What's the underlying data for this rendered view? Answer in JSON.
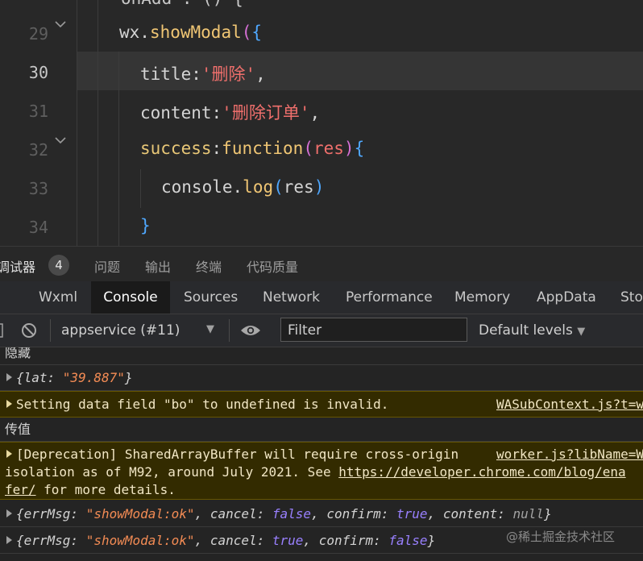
{
  "editor": {
    "line_numbers": [
      "29",
      "30",
      "31",
      "32",
      "33",
      "34"
    ],
    "active_line": "30",
    "top_partial": "onAdd : () {",
    "lines": {
      "l29_obj": "wx",
      "l29_dot": ".",
      "l29_fn": "showModal",
      "l29_paren": "(",
      "l29_brace": "{",
      "l30_key": "title",
      "l30_colon": ":",
      "l30_str": "'删除'",
      "l30_comma": ",",
      "l31_key": "content",
      "l31_colon": ":",
      "l31_str": "'删除订单'",
      "l31_comma": ",",
      "l32_key": "success",
      "l32_colon": ":",
      "l32_fn": "function",
      "l32_paren": "(",
      "l32_arg": "res",
      "l32_close": ")",
      "l32_brace": "{",
      "l33_obj": "console",
      "l33_dot": ".",
      "l33_fn": "log",
      "l33_paren": "(",
      "l33_arg": "res",
      "l33_close": ")",
      "l34_brace": "}"
    }
  },
  "panel_tabs": {
    "debugger": "调试器",
    "badge": "4",
    "problems": "问题",
    "output": "输出",
    "terminal": "终端",
    "quality": "代码质量"
  },
  "devtools_tabs": {
    "left_cut": "⴮",
    "wxml": "Wxml",
    "console": "Console",
    "sources": "Sources",
    "network": "Network",
    "performance": "Performance",
    "memory": "Memory",
    "appdata": "AppData",
    "storage": "Sto"
  },
  "toolbar": {
    "context": "appservice (#11)",
    "filter_placeholder": "Filter",
    "levels": "Default levels"
  },
  "console": {
    "r1": "隐藏",
    "r2_open": "{lat: ",
    "r2_val": "\"39.887\"",
    "r2_close": "}",
    "r3": "Setting data field \"bo\" to undefined is invalid.",
    "r3_src": "WASubContext.js?t=w",
    "r4": "传值",
    "r5_line1": "[Deprecation] SharedArrayBuffer will require cross-origin",
    "r5_src": "worker.js?libName=W",
    "r5_line2_a": "isolation as of M92, around July 2021. See ",
    "r5_link": "https://developer.chrome.com/blog/ena",
    "r5_line3_link": "fer/",
    "r5_line3_b": " for more details.",
    "r6": {
      "k1": "{errMsg: ",
      "v1": "\"showModal:ok\"",
      "k2": ", cancel: ",
      "v2": "false",
      "k3": ", confirm: ",
      "v3": "true",
      "k4": ", content: ",
      "v4": "null",
      "end": "}"
    },
    "r7": {
      "k1": "{errMsg: ",
      "v1": "\"showModal:ok\"",
      "k2": ", cancel: ",
      "v2": "true",
      "k3": ", confirm: ",
      "v3": "false",
      "end": "}"
    }
  },
  "watermark": "@稀土掘金技术社区"
}
